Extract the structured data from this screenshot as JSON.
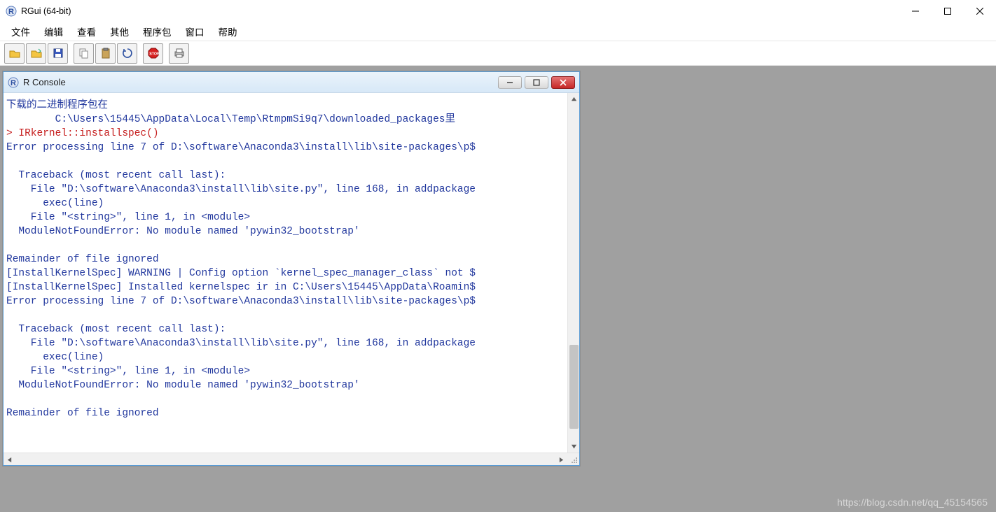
{
  "window": {
    "title": "RGui (64-bit)"
  },
  "menu": {
    "items": [
      "文件",
      "编辑",
      "查看",
      "其他",
      "程序包",
      "窗口",
      "帮助"
    ]
  },
  "toolbar": {
    "buttons": [
      {
        "name": "open-script-icon"
      },
      {
        "name": "load-workspace-icon"
      },
      {
        "name": "save-icon"
      },
      {
        "sep": true
      },
      {
        "name": "copy-icon"
      },
      {
        "name": "paste-icon"
      },
      {
        "name": "refresh-icon"
      },
      {
        "sep": true
      },
      {
        "name": "stop-icon"
      },
      {
        "sep": true
      },
      {
        "name": "print-icon"
      }
    ]
  },
  "console": {
    "title": "R Console",
    "lines": [
      {
        "cls": "blue",
        "text": "下载的二进制程序包在"
      },
      {
        "cls": "blue",
        "text": "        C:\\Users\\15445\\AppData\\Local\\Temp\\RtmpmSi9q7\\downloaded_packages里"
      },
      {
        "cls": "red",
        "text": "> IRkernel::installspec()"
      },
      {
        "cls": "blue",
        "text": "Error processing line 7 of D:\\software\\Anaconda3\\install\\lib\\site-packages\\p$"
      },
      {
        "cls": "blue",
        "text": ""
      },
      {
        "cls": "blue",
        "text": "  Traceback (most recent call last):"
      },
      {
        "cls": "blue",
        "text": "    File \"D:\\software\\Anaconda3\\install\\lib\\site.py\", line 168, in addpackage"
      },
      {
        "cls": "blue",
        "text": "      exec(line)"
      },
      {
        "cls": "blue",
        "text": "    File \"<string>\", line 1, in <module>"
      },
      {
        "cls": "blue",
        "text": "  ModuleNotFoundError: No module named 'pywin32_bootstrap'"
      },
      {
        "cls": "blue",
        "text": ""
      },
      {
        "cls": "blue",
        "text": "Remainder of file ignored"
      },
      {
        "cls": "blue",
        "text": "[InstallKernelSpec] WARNING | Config option `kernel_spec_manager_class` not $"
      },
      {
        "cls": "blue",
        "text": "[InstallKernelSpec] Installed kernelspec ir in C:\\Users\\15445\\AppData\\Roamin$"
      },
      {
        "cls": "blue",
        "text": "Error processing line 7 of D:\\software\\Anaconda3\\install\\lib\\site-packages\\p$"
      },
      {
        "cls": "blue",
        "text": ""
      },
      {
        "cls": "blue",
        "text": "  Traceback (most recent call last):"
      },
      {
        "cls": "blue",
        "text": "    File \"D:\\software\\Anaconda3\\install\\lib\\site.py\", line 168, in addpackage"
      },
      {
        "cls": "blue",
        "text": "      exec(line)"
      },
      {
        "cls": "blue",
        "text": "    File \"<string>\", line 1, in <module>"
      },
      {
        "cls": "blue",
        "text": "  ModuleNotFoundError: No module named 'pywin32_bootstrap'"
      },
      {
        "cls": "blue",
        "text": ""
      },
      {
        "cls": "blue",
        "text": "Remainder of file ignored"
      }
    ]
  },
  "watermark": "https://blog.csdn.net/qq_45154565"
}
